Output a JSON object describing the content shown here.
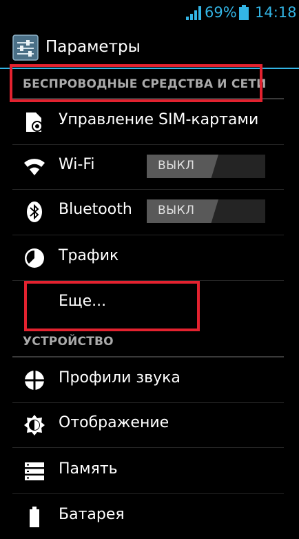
{
  "status_bar": {
    "battery_percent": "69%",
    "time": "14:18",
    "accent_color": "#33b5e5",
    "icons": [
      "signal-icon",
      "battery-icon"
    ]
  },
  "action_bar": {
    "title": "Параметры",
    "icon": "settings-app-icon"
  },
  "sections": [
    {
      "header": "БЕСПРОВОДНЫЕ СРЕДСТВА И СЕТИ",
      "items": [
        {
          "label": "Управление SIM-картами",
          "icon": "sim-card-icon"
        },
        {
          "label": "Wi-Fi",
          "icon": "wifi-icon",
          "toggle": "ВЫКЛ"
        },
        {
          "label": "Bluetooth",
          "icon": "bluetooth-icon",
          "toggle": "ВЫКЛ"
        },
        {
          "label": "Трафик",
          "icon": "data-usage-icon"
        },
        {
          "label": "Еще..."
        }
      ]
    },
    {
      "header": "УСТРОЙСТВО",
      "items": [
        {
          "label": "Профили звука",
          "icon": "sound-profiles-icon"
        },
        {
          "label": "Отображение",
          "icon": "display-icon"
        },
        {
          "label": "Память",
          "icon": "storage-icon"
        },
        {
          "label": "Батарея",
          "icon": "battery-settings-icon"
        }
      ]
    }
  ],
  "annotations": {
    "highlight_color": "#e3222f"
  }
}
